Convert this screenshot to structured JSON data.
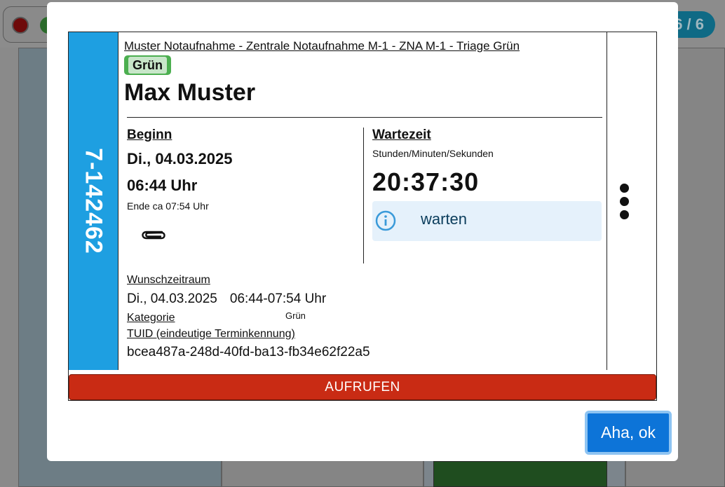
{
  "background": {
    "page_indicator": "6 / 6"
  },
  "card": {
    "id": "7-142462",
    "location": "Muster Notaufnahme - Zentrale Notaufnahme M-1 - ZNA M-1 - Triage Grün",
    "triage_badge": "Grün",
    "patient_name": "Max Muster",
    "begin": {
      "title": "Beginn",
      "date": "Di., 04.03.2025",
      "time": "06:44 Uhr",
      "end_note": "Ende ca 07:54 Uhr"
    },
    "wait": {
      "title": "Wartezeit",
      "unit": "Stunden/Minuten/Sekunden",
      "timer": "20:37:30",
      "status": "warten"
    },
    "details": {
      "wish_label": "Wunschzeitraum",
      "wish_date": "Di., 04.03.2025",
      "wish_time": "06:44-07:54 Uhr",
      "category_label": "Kategorie",
      "category_value": "Grün",
      "tuid_label": "TUID (eindeutige Terminkennung)",
      "tuid_value": "bcea487a-248d-40fd-ba13-fb34e62f22a5"
    },
    "call_button": "AUFRUFEN"
  },
  "ok_button": "Aha, ok",
  "colors": {
    "id_strip": "#1e9fe1",
    "triage_green": "#4caf50",
    "call_red": "#c92b14",
    "ok_blue": "#0d74d8",
    "status_bg": "#e5f1fb"
  },
  "icons": {
    "attachment": "paperclip-icon",
    "info": "info-icon",
    "menu": "more-vertical-icon"
  }
}
